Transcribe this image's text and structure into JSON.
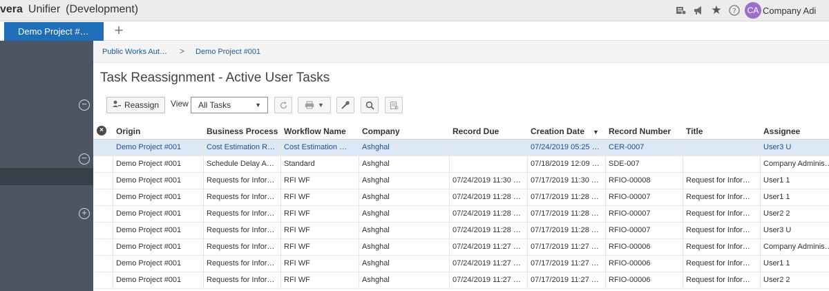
{
  "topbar": {
    "brand_bold": "vera",
    "app_name": "Unifier",
    "environment": "(Development)",
    "icons": [
      "news-icon",
      "megaphone-icon",
      "star-icon",
      "help-icon"
    ],
    "user_initials": "CA",
    "user_name": "Company Adi"
  },
  "tabs": {
    "active_label": "Demo Project #…",
    "add_symbol": "+"
  },
  "breadcrumb": {
    "items": [
      "Public Works Aut…",
      "Demo Project #001"
    ],
    "separator": ">"
  },
  "page": {
    "title": "Task Reassignment - Active User Tasks"
  },
  "toolbar": {
    "reassign_label": "Reassign",
    "view_label": "View",
    "view_selected": "All Tasks"
  },
  "grid": {
    "columns": [
      "Origin",
      "Business Process",
      "Workflow Name",
      "Company",
      "Record Due",
      "Creation Date",
      "Record Number",
      "Title",
      "Assignee"
    ],
    "sorted_column": "Creation Date",
    "sort_direction": "descending",
    "selected_row": 0,
    "rows": [
      [
        "Demo Project #001",
        "Cost Estimation R…",
        "Cost Estimation …",
        "Ashghal",
        "",
        "07/24/2019 05:25 …",
        "CER-0007",
        "",
        "User3 U"
      ],
      [
        "Demo Project #001",
        "Schedule Delay A…",
        "Standard",
        "Ashghal",
        "",
        "07/18/2019 12:09 …",
        "SDE-007",
        "",
        "Company Adminis…"
      ],
      [
        "Demo Project #001",
        "Requests for Infor…",
        "RFI WF",
        "Ashghal",
        "07/24/2019 11:30 …",
        "07/17/2019 11:30 …",
        "RFIO-00008",
        "Request for Infor…",
        "User1 1"
      ],
      [
        "Demo Project #001",
        "Requests for Infor…",
        "RFI WF",
        "Ashghal",
        "07/24/2019 11:28 …",
        "07/17/2019 11:28 …",
        "RFIO-00007",
        "Request for Infor…",
        "User1 1"
      ],
      [
        "Demo Project #001",
        "Requests for Infor…",
        "RFI WF",
        "Ashghal",
        "07/24/2019 11:28 …",
        "07/17/2019 11:28 …",
        "RFIO-00007",
        "Request for Infor…",
        "User2 2"
      ],
      [
        "Demo Project #001",
        "Requests for Infor…",
        "RFI WF",
        "Ashghal",
        "07/24/2019 11:28 …",
        "07/17/2019 11:28 …",
        "RFIO-00007",
        "Request for Infor…",
        "User3 U"
      ],
      [
        "Demo Project #001",
        "Requests for Infor…",
        "RFI WF",
        "Ashghal",
        "07/24/2019 11:27 …",
        "07/17/2019 11:27 …",
        "RFIO-00006",
        "Request for Infor…",
        "Company Adminis…"
      ],
      [
        "Demo Project #001",
        "Requests for Infor…",
        "RFI WF",
        "Ashghal",
        "07/24/2019 11:27 …",
        "07/17/2019 11:27 …",
        "RFIO-00006",
        "Request for Infor…",
        "User1 1"
      ],
      [
        "Demo Project #001",
        "Requests for Infor…",
        "RFI WF",
        "Ashghal",
        "07/24/2019 11:27 …",
        "07/17/2019 11:27 …",
        "RFIO-00006",
        "Request for Infor…",
        "User2 2"
      ]
    ]
  }
}
